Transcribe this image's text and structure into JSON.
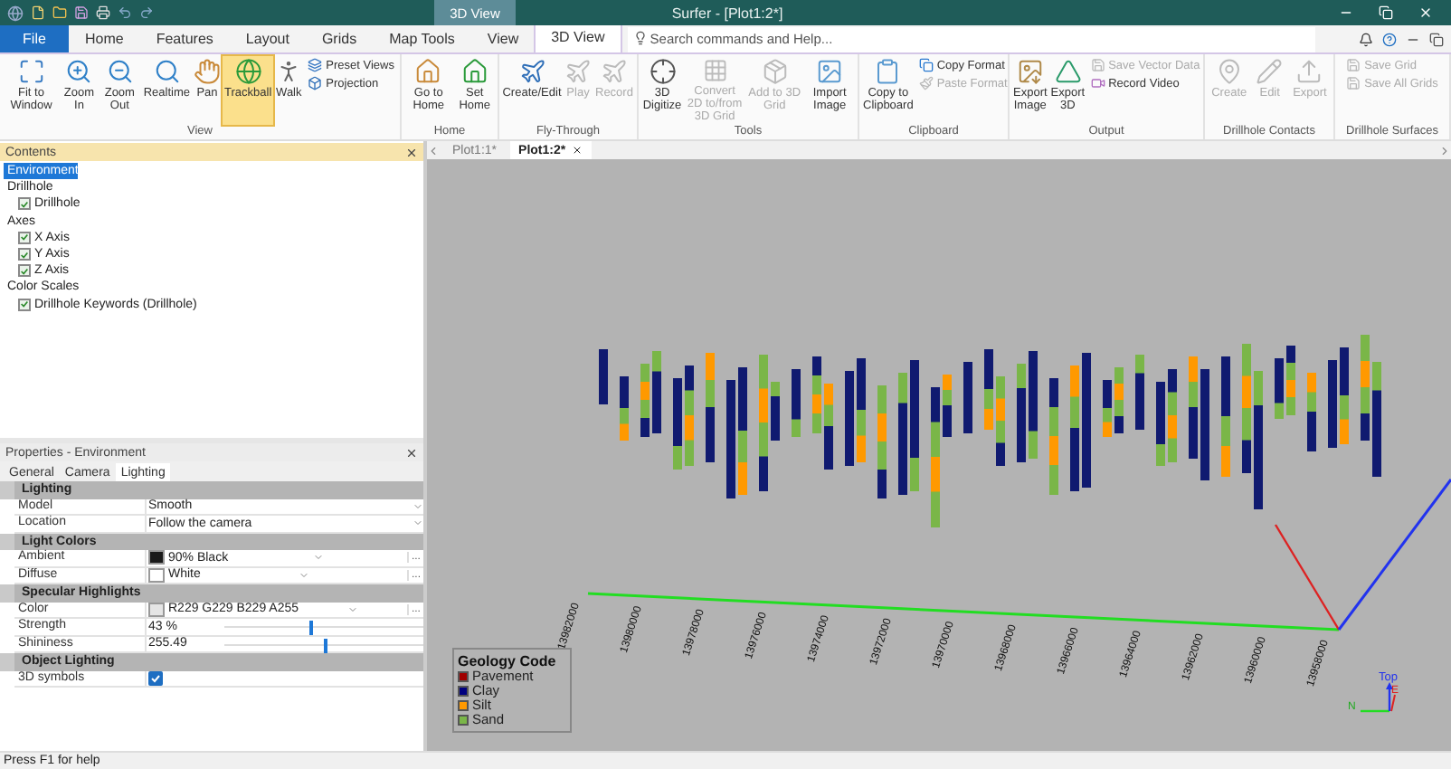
{
  "window": {
    "title": "Surfer - [Plot1:2*]",
    "context_tab": "3D View"
  },
  "ribbon_tabs": [
    {
      "label": "File",
      "kind": "file",
      "selected": false
    },
    {
      "label": "Home",
      "kind": "tab",
      "selected": false
    },
    {
      "label": "Features",
      "kind": "tab",
      "selected": false
    },
    {
      "label": "Layout",
      "kind": "tab",
      "selected": false
    },
    {
      "label": "Grids",
      "kind": "tab",
      "selected": false
    },
    {
      "label": "Map Tools",
      "kind": "tab",
      "selected": false
    },
    {
      "label": "View",
      "kind": "tab",
      "selected": false
    },
    {
      "label": "3D View",
      "kind": "tab",
      "selected": true
    }
  ],
  "search": {
    "placeholder": "Search commands and Help..."
  },
  "ribbon_groups": [
    {
      "label": "View",
      "buttons": [
        {
          "label": "Fit to Window",
          "kind": "large",
          "disabled": false
        },
        {
          "label": "Zoom In",
          "kind": "large",
          "disabled": false
        },
        {
          "label": "Zoom Out",
          "kind": "large",
          "disabled": false
        },
        {
          "label": "Realtime",
          "kind": "large",
          "disabled": false
        },
        {
          "label": "Pan",
          "kind": "large",
          "disabled": false
        },
        {
          "label": "Trackball",
          "kind": "large",
          "disabled": false,
          "active": true
        },
        {
          "label": "Walk",
          "kind": "large",
          "disabled": false
        },
        {
          "label": "Preset Views",
          "kind": "small",
          "disabled": false
        },
        {
          "label": "Projection",
          "kind": "small",
          "disabled": false
        }
      ]
    },
    {
      "label": "Home",
      "buttons": [
        {
          "label": "Go to Home",
          "kind": "large",
          "disabled": false
        },
        {
          "label": "Set Home",
          "kind": "large",
          "disabled": false
        }
      ]
    },
    {
      "label": "Fly-Through",
      "buttons": [
        {
          "label": "Create/Edit",
          "kind": "large",
          "disabled": false
        },
        {
          "label": "Play",
          "kind": "large",
          "disabled": true
        },
        {
          "label": "Record",
          "kind": "large",
          "disabled": true
        }
      ]
    },
    {
      "label": "Tools",
      "buttons": [
        {
          "label": "3D Digitize",
          "kind": "large",
          "disabled": false
        },
        {
          "label": "Convert 2D to/from 3D Grid",
          "kind": "large",
          "disabled": true
        },
        {
          "label": "Add to 3D Grid",
          "kind": "large",
          "disabled": true
        },
        {
          "label": "Import Image",
          "kind": "large",
          "disabled": false
        }
      ]
    },
    {
      "label": "Clipboard",
      "buttons": [
        {
          "label": "Copy to Clipboard",
          "kind": "large",
          "disabled": false
        },
        {
          "label": "Copy Format",
          "kind": "small",
          "disabled": false
        },
        {
          "label": "Paste Format",
          "kind": "small",
          "disabled": true
        }
      ]
    },
    {
      "label": "Output",
      "buttons": [
        {
          "label": "Export Image",
          "kind": "large",
          "disabled": false
        },
        {
          "label": "Export 3D",
          "kind": "large",
          "disabled": false
        },
        {
          "label": "Save Vector Data",
          "kind": "small",
          "disabled": true
        },
        {
          "label": "Record Video",
          "kind": "small",
          "disabled": false
        }
      ]
    },
    {
      "label": "Drillhole Contacts",
      "buttons": [
        {
          "label": "Create",
          "kind": "large",
          "disabled": true
        },
        {
          "label": "Edit",
          "kind": "large",
          "disabled": true
        },
        {
          "label": "Export",
          "kind": "large",
          "disabled": true
        }
      ]
    },
    {
      "label": "Drillhole Surfaces",
      "buttons": [
        {
          "label": "Save Grid",
          "kind": "small",
          "disabled": true
        },
        {
          "label": "Save All Grids",
          "kind": "small",
          "disabled": true
        }
      ]
    }
  ],
  "contents": {
    "title": "Contents",
    "items": [
      {
        "label": "Environment",
        "selected": true
      },
      {
        "label": "Drillhole",
        "selected": false,
        "children": [
          {
            "label": "Drillhole",
            "checked": true,
            "selected": false
          }
        ]
      },
      {
        "label": "Axes",
        "selected": false,
        "children": [
          {
            "label": "X Axis",
            "checked": true,
            "selected": false
          },
          {
            "label": "Y Axis",
            "checked": true,
            "selected": false
          },
          {
            "label": "Z Axis",
            "checked": true,
            "selected": false
          }
        ]
      },
      {
        "label": "Color Scales",
        "selected": false,
        "children": [
          {
            "label": "Drillhole Keywords (Drillhole)",
            "checked": true,
            "selected": false
          }
        ]
      }
    ]
  },
  "properties": {
    "title": "Properties - Environment",
    "tabs": [
      {
        "label": "General",
        "selected": false
      },
      {
        "label": "Camera",
        "selected": false
      },
      {
        "label": "Lighting",
        "selected": true
      }
    ],
    "sections": [
      {
        "label": "Lighting",
        "rows": [
          {
            "label": "Model",
            "value": "Smooth",
            "kind": "dropdown"
          },
          {
            "label": "Location",
            "value": "Follow the camera",
            "kind": "dropdown"
          }
        ]
      },
      {
        "label": "Light Colors",
        "rows": [
          {
            "label": "Ambient",
            "value": "90% Black",
            "kind": "color",
            "color": "#1a1a1a",
            "more": "..."
          },
          {
            "label": "Diffuse",
            "value": "White",
            "kind": "color",
            "color": "#ffffff",
            "more": "..."
          }
        ]
      },
      {
        "label": "Specular Highlights",
        "rows": [
          {
            "label": "Color",
            "value": "R229 G229 B229 A255",
            "kind": "color",
            "color": "#e5e5e5",
            "more": "..."
          },
          {
            "label": "Strength",
            "value": "43 %",
            "kind": "slider",
            "level": 0.43
          },
          {
            "label": "Shininess",
            "value": "255.49",
            "kind": "slider",
            "level": 0.5
          }
        ]
      },
      {
        "label": "Object Lighting",
        "rows": [
          {
            "label": "3D symbols",
            "kind": "checkbox",
            "checked": true
          }
        ]
      }
    ]
  },
  "documents": [
    {
      "label": "Plot1:1*",
      "selected": false
    },
    {
      "label": "Plot1:2*",
      "selected": true
    }
  ],
  "view3d": {
    "x_axis_labels": [
      "13982000",
      "13980000",
      "13978000",
      "13976000",
      "13974000",
      "13972000",
      "13970000",
      "13968000",
      "13966000",
      "13964000",
      "13962000",
      "13960000",
      "13958000"
    ],
    "legend": {
      "title": "Geology Code",
      "items": [
        {
          "label": "Pavement",
          "color": "#a00000"
        },
        {
          "label": "Clay",
          "color": "#00007f"
        },
        {
          "label": "Silt",
          "color": "#ff9900"
        },
        {
          "label": "Sand",
          "color": "#7ab648"
        }
      ]
    },
    "orientation": {
      "top": "Top",
      "east": "E",
      "north": "N"
    }
  },
  "status_bar": {
    "text": "Press F1 for help"
  }
}
